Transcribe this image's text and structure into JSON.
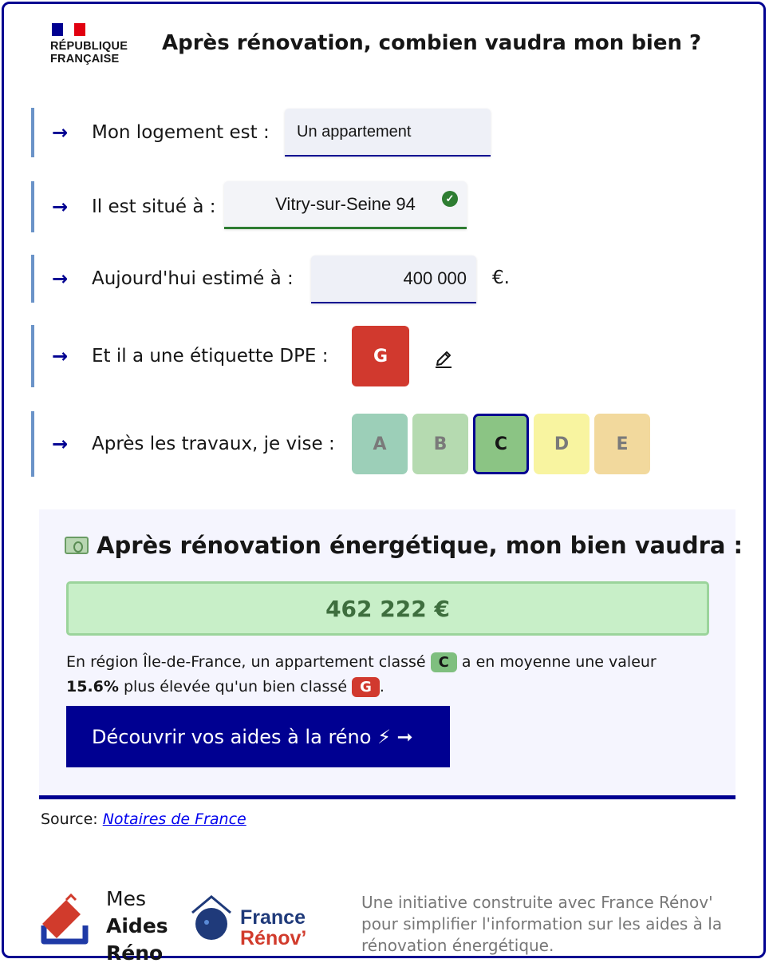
{
  "header": {
    "rf_line1": "RÉPUBLIQUE",
    "rf_line2": "FRANÇAISE",
    "title": "Après rénovation, combien vaudra mon bien ?"
  },
  "form": {
    "type_label": "Mon logement est :",
    "type_value": "Un appartement",
    "city_label": "Il est situé à :",
    "city_value": "Vitry-sur-Seine 94",
    "price_label": "Aujourd'hui estimé à :",
    "price_value": "400 000",
    "price_unit": "€.",
    "dpe_label": "Et il a une étiquette DPE :",
    "dpe_current": "G",
    "target_label": "Après les travaux, je vise :",
    "grades": [
      {
        "letter": "A",
        "color": "#9ccfb8",
        "selected": false
      },
      {
        "letter": "B",
        "color": "#b5dab0",
        "selected": false
      },
      {
        "letter": "C",
        "color": "#8bc484",
        "selected": true
      },
      {
        "letter": "D",
        "color": "#f8f4a0",
        "selected": false
      },
      {
        "letter": "E",
        "color": "#f2d99d",
        "selected": false
      }
    ]
  },
  "result": {
    "title": "Après rénovation énergétique, mon bien vaudra :",
    "value": "462 222 €",
    "explain_before": "En région Île-de-France, un appartement classé",
    "target_grade": "C",
    "explain_middle": "a en moyenne une valeur",
    "percent": "15.6%",
    "explain_after": "plus élevée qu'un bien classé",
    "current_grade": "G",
    "explain_end": ".",
    "cta_label": "Découvrir vos aides à la réno ⚡ ➞"
  },
  "source": {
    "label": "Source:",
    "link": "Notaires de France"
  },
  "footer": {
    "mar_line1": "Mes",
    "mar_line2": "Aides",
    "mar_line3": "Réno",
    "fr_line1": "France",
    "fr_line2": "Rénov’",
    "text": "Une initiative construite avec France Rénov' pour simplifier l'information sur les aides à la rénovation énergétique."
  },
  "colors": {
    "brand_blue": "#000091",
    "dpe_g_red": "#d1392e",
    "success_green": "#2e7d32"
  }
}
